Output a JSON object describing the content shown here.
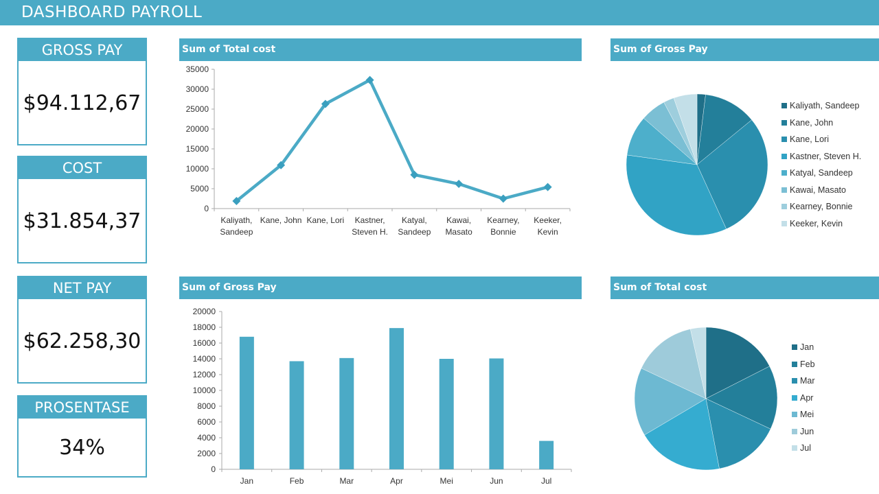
{
  "header": {
    "title": "DASHBOARD PAYROLL"
  },
  "kpis": [
    {
      "label": "GROSS PAY",
      "value": "$94.112,67"
    },
    {
      "label": "COST",
      "value": "$31.854,37"
    },
    {
      "label": "NET PAY",
      "value": "$62.258,30"
    },
    {
      "label": "PROSENTASE",
      "value": "34%"
    }
  ],
  "colors": {
    "accent": "#4BAAC6",
    "pie_employees": [
      "#1F6F88",
      "#237F9A",
      "#2A8FAE",
      "#31A3C5",
      "#4DAFCB",
      "#7BBFD4",
      "#9ECEDD",
      "#C3DFE8"
    ],
    "pie_months": [
      "#1F6F88",
      "#237F9A",
      "#2A8FAE",
      "#35ACD0",
      "#6DB9D2",
      "#9ECBDA",
      "#C3DFE8"
    ]
  },
  "chart_data": [
    {
      "id": "line-total-cost",
      "type": "line",
      "title": "Sum of Total cost",
      "categories": [
        [
          "Kaliyath,",
          "Sandeep"
        ],
        [
          "Kane, John"
        ],
        [
          "Kane, Lori"
        ],
        [
          "Kastner,",
          "Steven H."
        ],
        [
          "Katyal,",
          "Sandeep"
        ],
        [
          "Kawai,",
          "Masato"
        ],
        [
          "Kearney,",
          "Bonnie"
        ],
        [
          "Keeker,",
          "Kevin"
        ]
      ],
      "values": [
        1900,
        10900,
        26300,
        32300,
        8500,
        6200,
        2500,
        5400
      ],
      "yticks": [
        0,
        5000,
        10000,
        15000,
        20000,
        25000,
        30000,
        35000
      ],
      "ylim": [
        0,
        35000
      ],
      "xlabel": "",
      "ylabel": "",
      "grid": false,
      "color": "#4BAAC6"
    },
    {
      "id": "pie-gross-pay",
      "type": "pie",
      "title": "Sum of Gross Pay",
      "labels": [
        "Kaliyath, Sandeep",
        "Kane, John",
        "Kane, Lori",
        "Kastner, Steven H.",
        "Katyal, Sandeep",
        "Kawai, Masato",
        "Kearney, Bonnie",
        "Keeker, Kevin"
      ],
      "values": [
        2,
        12.5,
        30,
        35,
        9.5,
        6,
        2.5,
        5.5
      ],
      "legend": "right"
    },
    {
      "id": "bar-gross-pay",
      "type": "bar",
      "title": "Sum of Gross Pay",
      "categories": [
        "Jan",
        "Feb",
        "Mar",
        "Apr",
        "Mei",
        "Jun",
        "Jul"
      ],
      "values": [
        16800,
        13700,
        14100,
        17900,
        14000,
        14050,
        3600
      ],
      "yticks": [
        0,
        2000,
        4000,
        6000,
        8000,
        10000,
        12000,
        14000,
        16000,
        18000,
        20000
      ],
      "ylim": [
        0,
        20000
      ],
      "xlabel": "",
      "ylabel": "",
      "grid": false,
      "color": "#4BAAC6"
    },
    {
      "id": "pie-total-cost",
      "type": "pie",
      "title": "Sum of Total cost",
      "labels": [
        "Jan",
        "Feb",
        "Mar",
        "Apr",
        "Mei",
        "Jun",
        "Jul"
      ],
      "values": [
        17.5,
        14.5,
        15,
        19.5,
        15.5,
        14.5,
        3.5
      ],
      "legend": "right"
    }
  ]
}
